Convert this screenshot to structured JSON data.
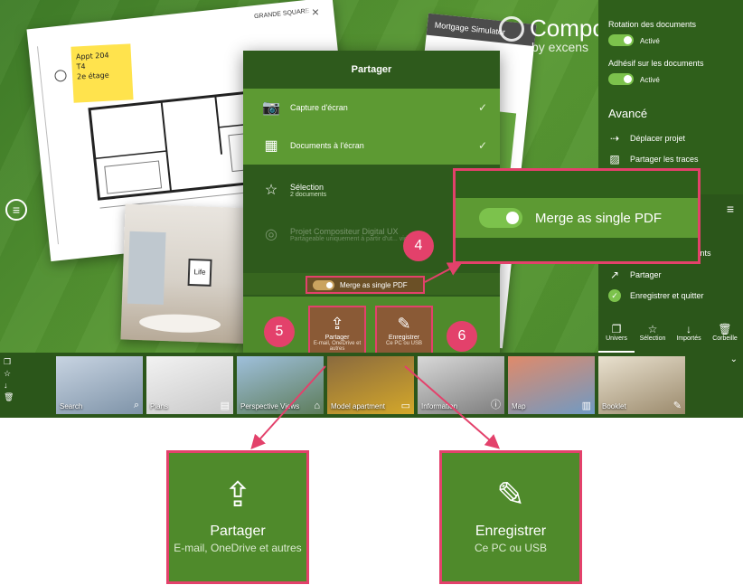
{
  "colors": {
    "accent": "#e3416b",
    "green_dark": "#2e5a1c",
    "green_light": "#5d9a33"
  },
  "canvas": {
    "sticky_note": "Appt 204\nT4\n2e étage",
    "logo_card": "GRANDE\nSQUARE",
    "photo_art": "Life",
    "mortgage_title": "Mortgage Simulator",
    "brand": "Compos",
    "brand_sub": "by excens"
  },
  "right_panel": {
    "rotation_label": "Rotation des documents",
    "rotation_value": "Activé",
    "adhesif_label": "Adhésif sur les documents",
    "adhesif_value": "Activé",
    "advanced_header": "Avancé",
    "items": [
      {
        "label": "Déplacer projet",
        "icon": "move-icon"
      },
      {
        "label": "Partager les traces",
        "icon": "share-traces-icon"
      }
    ],
    "lower_items": [
      {
        "label": "ments",
        "icon": "documents-icon"
      },
      {
        "label": "Partager",
        "icon": "share-icon"
      },
      {
        "label": "Enregistrer et quitter",
        "icon": "check-circle-icon"
      }
    ],
    "tabs": [
      {
        "label": "Univers",
        "icon": "univers-icon"
      },
      {
        "label": "Sélection",
        "icon": "selection-icon"
      },
      {
        "label": "Importés",
        "icon": "download-icon"
      },
      {
        "label": "Corbeille",
        "icon": "trash-icon"
      }
    ]
  },
  "dialog": {
    "title": "Partager",
    "options": [
      {
        "label": "Capture d'écran",
        "sub": "",
        "icon": "camera-icon"
      },
      {
        "label": "Documents à l'écran",
        "sub": "",
        "icon": "layout-icon"
      },
      {
        "label": "Sélection",
        "sub": "2 documents",
        "icon": "star-list-icon"
      },
      {
        "label": "Projet Compositeur Digital UX",
        "sub": "Partageable uniquement à partir d'ut... vidéo",
        "icon": "compositeur-icon"
      }
    ],
    "merge_label": "Merge as single PDF",
    "share_btn": {
      "label": "Partager",
      "sub": "E-mail, OneDrive et autres"
    },
    "save_btn": {
      "label": "Enregistrer",
      "sub": "Ce PC ou USB"
    }
  },
  "badges": {
    "b4": "4",
    "b5": "5",
    "b6": "6"
  },
  "callout": {
    "label": "Merge as single PDF"
  },
  "bottom_bar": {
    "tiles": [
      {
        "label": "Search",
        "icon": "search-icon"
      },
      {
        "label": "Plans",
        "icon": "plans-icon"
      },
      {
        "label": "Perspective Views",
        "icon": "building-icon"
      },
      {
        "label": "Model apartment",
        "icon": "sofa-icon"
      },
      {
        "label": "Information",
        "icon": "info-icon"
      },
      {
        "label": "Map",
        "icon": "map-icon"
      },
      {
        "label": "Booklet",
        "icon": "book-icon"
      }
    ]
  },
  "zoom": {
    "share": {
      "label": "Partager",
      "sub": "E-mail, OneDrive et autres"
    },
    "save": {
      "label": "Enregistrer",
      "sub": "Ce PC ou USB"
    }
  }
}
